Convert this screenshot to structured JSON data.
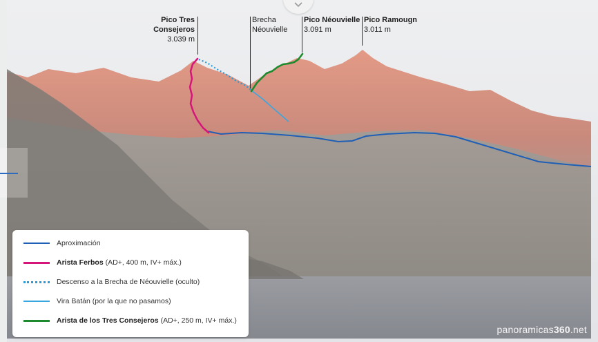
{
  "peaks": [
    {
      "id": "tres-consejeros",
      "name": "Pico Tres Consejeros",
      "altitude": "3.039 m",
      "name_bold": true
    },
    {
      "id": "brecha",
      "name": "Brecha",
      "altitude": "Néouvielle",
      "name_bold": false
    },
    {
      "id": "neouvielle",
      "name": "Pico Néouvielle",
      "altitude": "3.091 m",
      "name_bold": true
    },
    {
      "id": "ramougn",
      "name": "Pico Ramougn",
      "altitude": "3.011 m",
      "name_bold": true
    }
  ],
  "legend": {
    "items": [
      {
        "id": "aproximacion",
        "style": "solid",
        "color": "#1f5fb5",
        "label_bold": "",
        "label": "Aproximación"
      },
      {
        "id": "arista-ferbos",
        "style": "solid",
        "color": "#d4157a",
        "label_bold": "Arista Ferbos",
        "label": " (AD+, 400 m, IV+ máx.)"
      },
      {
        "id": "descenso",
        "style": "dotted",
        "color": "#2a9ad6",
        "label_bold": "",
        "label": "Descenso a la Brecha de Néouvielle (oculto)"
      },
      {
        "id": "vira-batan",
        "style": "solid",
        "color": "#3aa6e0",
        "label_bold": "",
        "label": "Vira Batán (por la que no pasamos)"
      },
      {
        "id": "arista-tres-consejeros",
        "style": "solid",
        "color": "#1e8a2e",
        "label_bold": "Arista de los Tres Consejeros",
        "label": " (AD+, 250 m, IV+  máx.)"
      }
    ]
  },
  "watermark": {
    "prefix": "panoramicas",
    "bold": "360",
    "suffix": ".net"
  },
  "colors": {
    "sky": "#e8e9ec",
    "alpenglow": "#d98a78",
    "rock": "#8a8680",
    "lake": "#8e9097"
  },
  "icons": {
    "toggle": "chevron-down-icon"
  }
}
